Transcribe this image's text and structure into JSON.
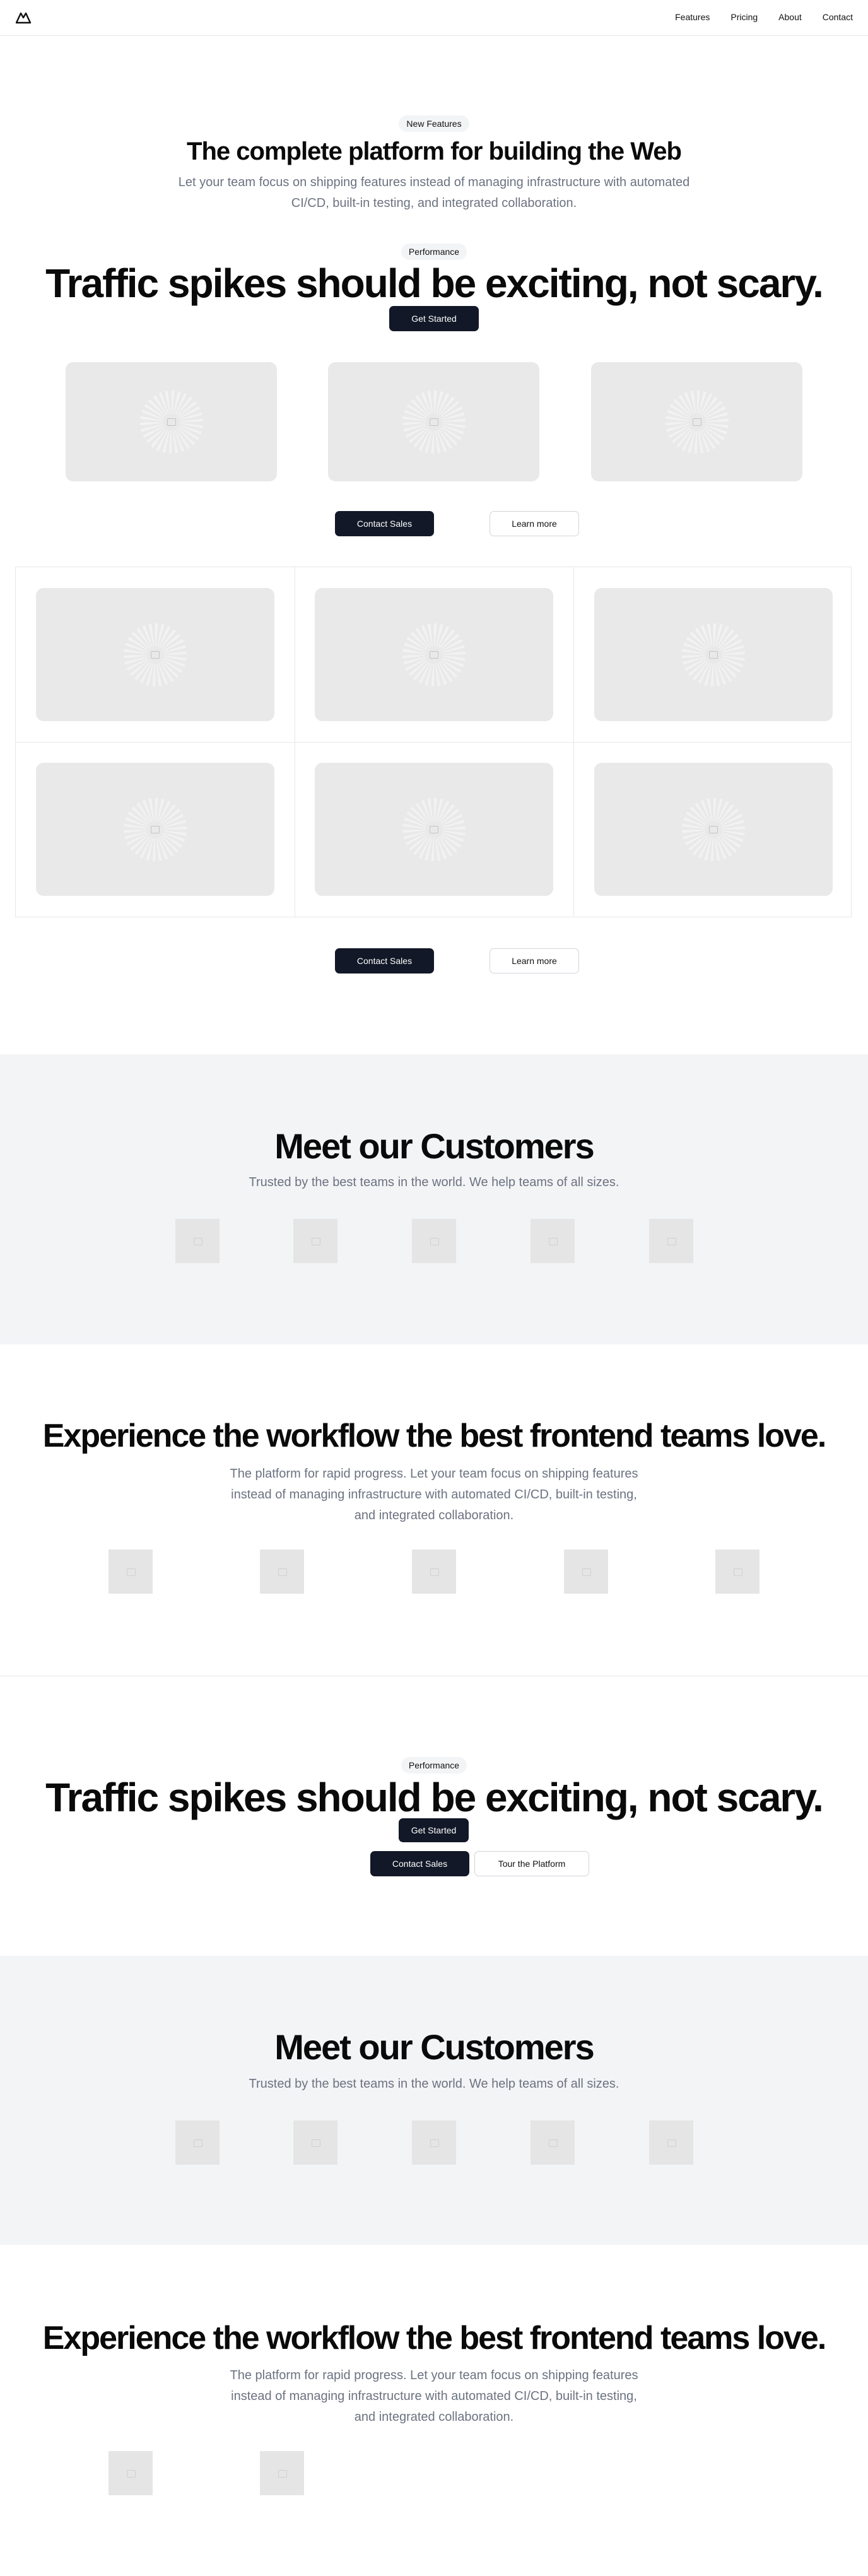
{
  "nav": {
    "logo": "triangle-logo",
    "items": [
      "Features",
      "Pricing",
      "About",
      "Contact"
    ]
  },
  "section1": {
    "badge": "New Features",
    "title": "The complete platform for building the Web",
    "subtitle_line1": "Let your team focus on shipping features instead of managing infrastructure with automated",
    "subtitle_line2": "CI/CD, built-in testing, and integrated collaboration."
  },
  "section2": {
    "badge": "Performance",
    "title": "Traffic spikes should be exciting, not scary.",
    "cta": "Get Started",
    "contact": "Contact Sales",
    "learn": "Learn more"
  },
  "section3": {
    "contact": "Contact Sales",
    "learn": "Learn more"
  },
  "customers1": {
    "title": "Meet our Customers",
    "subtitle": "Trusted by the best teams in the world. We help teams of all sizes."
  },
  "workflow1": {
    "title": "Experience the workflow the best frontend teams love.",
    "line1": "The platform for rapid progress. Let your team focus on shipping features",
    "line2": "instead of managing infrastructure with automated CI/CD, built-in testing,",
    "line3": "and integrated collaboration."
  },
  "perf2": {
    "badge": "Performance",
    "title": "Traffic spikes should be exciting, not scary.",
    "cta": "Get Started",
    "contact": "Contact Sales",
    "tour": "Tour the Platform"
  },
  "customers2": {
    "title": "Meet our Customers",
    "subtitle": "Trusted by the best teams in the world. We help teams of all sizes."
  },
  "workflow2": {
    "title": "Experience the workflow the best frontend teams love.",
    "line1": "The platform for rapid progress. Let your team focus on shipping features",
    "line2": "instead of managing infrastructure with automated CI/CD, built-in testing,",
    "line3": "and integrated collaboration."
  },
  "colors": {
    "dark_button": "#121827",
    "band": "#f3f4f6",
    "placeholder": "#e9e9e9"
  }
}
